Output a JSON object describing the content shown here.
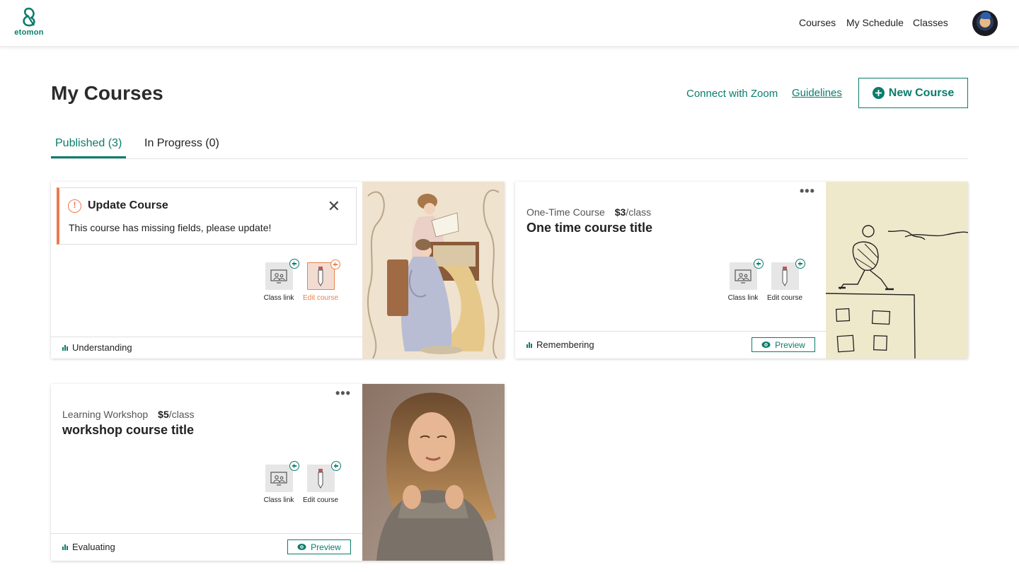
{
  "header": {
    "logo_text": "etomon",
    "nav": [
      "Courses",
      "My Schedule",
      "Classes"
    ],
    "brand_color": "#0a7c6c"
  },
  "page": {
    "title": "My Courses",
    "connect_zoom": "Connect with Zoom",
    "guidelines": "Guidelines",
    "new_course": "New Course"
  },
  "tabs": [
    {
      "label": "Published (3)",
      "active": true
    },
    {
      "label": "In Progress (0)",
      "active": false
    }
  ],
  "cards": [
    {
      "alert": {
        "title": "Update Course",
        "message": "This course has missing fields, please update!"
      },
      "class_link": "Class link",
      "edit_course": "Edit course",
      "level": "Understanding",
      "image": "vintage-painting-two-women-at-piano"
    },
    {
      "type": "One-Time Course",
      "price": "$3",
      "price_unit": "/class",
      "title": "One time course title",
      "class_link": "Class link",
      "edit_course": "Edit course",
      "level": "Remembering",
      "preview": "Preview",
      "image": "line-drawing-man-running-on-building"
    },
    {
      "type": "Learning Workshop",
      "price": "$5",
      "price_unit": "/class",
      "title": "workshop course title",
      "class_link": "Class link",
      "edit_course": "Edit course",
      "level": "Evaluating",
      "preview": "Preview",
      "image": "portrait-woman-with-long-hair"
    }
  ]
}
